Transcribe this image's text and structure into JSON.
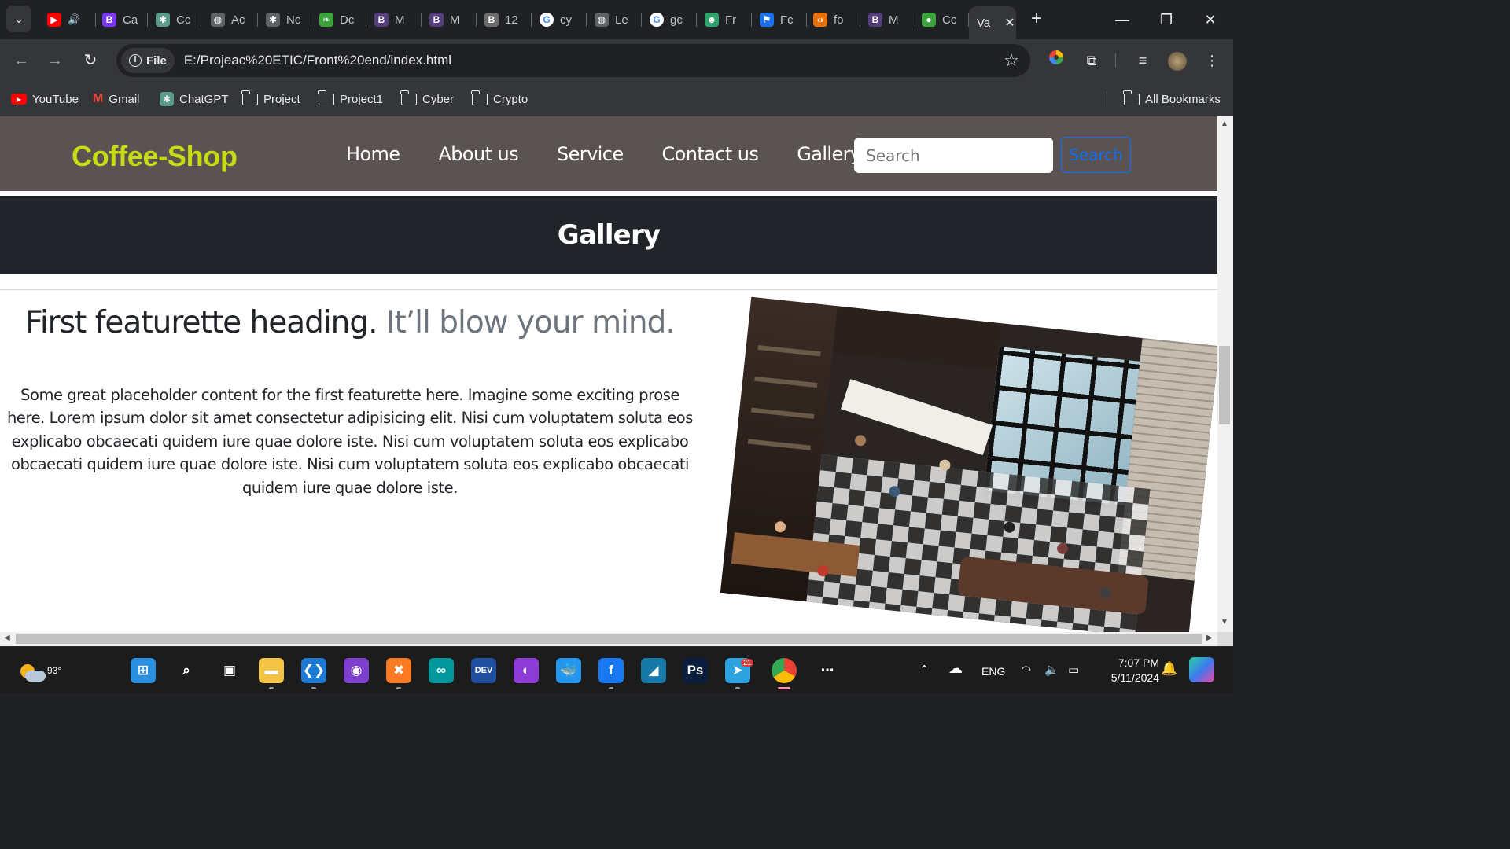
{
  "browser": {
    "tabs": [
      {
        "label": "",
        "favicon": "youtube-icon",
        "color": "#ff0000",
        "glyph": "▶",
        "extra": "🔊"
      },
      {
        "label": "Ca",
        "favicon": "bootstrap-icon",
        "color": "#7a38f5",
        "glyph": "B"
      },
      {
        "label": "Cc",
        "favicon": "chatgpt-icon",
        "color": "#5b9b8a",
        "glyph": "✱"
      },
      {
        "label": "Ac",
        "favicon": "globe-icon",
        "color": "#5f6368",
        "glyph": "◍"
      },
      {
        "label": "Nc",
        "favicon": "chatgpt-icon",
        "color": "#5f6368",
        "glyph": "✱"
      },
      {
        "label": "Dc",
        "favicon": "leaf-icon",
        "color": "#3aa33a",
        "glyph": "❧"
      },
      {
        "label": "M",
        "favicon": "bootstrap-icon",
        "color": "#563d7c",
        "glyph": "B"
      },
      {
        "label": "M",
        "favicon": "bootstrap-icon",
        "color": "#563d7c",
        "glyph": "B"
      },
      {
        "label": "12",
        "favicon": "bootstrap-icon",
        "color": "#6c6c6c",
        "glyph": "B"
      },
      {
        "label": "cy",
        "favicon": "google-icon",
        "color": "#ffffff",
        "glyph": "G"
      },
      {
        "label": "Le",
        "favicon": "globe-icon",
        "color": "#5f6368",
        "glyph": "◍"
      },
      {
        "label": "gc",
        "favicon": "google-icon",
        "color": "#ffffff",
        "glyph": "G"
      },
      {
        "label": "Fr",
        "favicon": "robot-icon",
        "color": "#2fa36b",
        "glyph": "☻"
      },
      {
        "label": "Fc",
        "favicon": "flag-icon",
        "color": "#1a73e8",
        "glyph": "⚑"
      },
      {
        "label": "fo",
        "favicon": "code-icon",
        "color": "#e8710a",
        "glyph": "‹›"
      },
      {
        "label": "M",
        "favicon": "bootstrap-icon",
        "color": "#563d7c",
        "glyph": "B"
      },
      {
        "label": "Cc",
        "favicon": "cookie-icon",
        "color": "#3aa33a",
        "glyph": "●"
      },
      {
        "label": "Va",
        "favicon": "",
        "color": "",
        "glyph": "",
        "active": true
      }
    ],
    "address": {
      "chip_label": "File",
      "url": "E:/Projeac%20ETIC/Front%20end/index.html"
    },
    "bookmarks": [
      {
        "label": "YouTube",
        "icon": "youtube-icon"
      },
      {
        "label": "Gmail",
        "icon": "gmail-icon"
      },
      {
        "label": "ChatGPT",
        "icon": "chatgpt-icon"
      },
      {
        "label": "Project",
        "icon": "folder-icon"
      },
      {
        "label": "Project1",
        "icon": "folder-icon"
      },
      {
        "label": "Cyber",
        "icon": "folder-icon"
      },
      {
        "label": "Crypto",
        "icon": "folder-icon"
      }
    ],
    "all_bookmarks_label": "All Bookmarks"
  },
  "site": {
    "brand": "Coffee-Shop",
    "nav": [
      "Home",
      "About us",
      "Service",
      "Contact us",
      "Gallery"
    ],
    "search_placeholder": "Search",
    "search_button": "Search",
    "banner_title": "Gallery",
    "featurette": {
      "heading": "First featurette heading.",
      "heading_muted": "It’ll blow your mind.",
      "text": "Some great placeholder content for the first featurette here. Imagine some exciting prose here. Lorem ipsum dolor sit amet consectetur adipisicing elit. Nisi cum voluptatem soluta eos explicabo obcaecati quidem iure quae dolore iste. Nisi cum voluptatem soluta eos explicabo obcaecati quidem iure quae dolore iste. Nisi cum voluptatem soluta eos explicabo obcaecati quidem iure quae dolore iste."
    },
    "brand_color": "#c8dc14",
    "navbar_color": "#5a5351",
    "banner_color": "#212529"
  },
  "taskbar": {
    "weather_temp": "93°",
    "apps": [
      {
        "name": "windows-start-icon",
        "glyph": "⊞",
        "color": "#2b8fe0"
      },
      {
        "name": "search-icon",
        "glyph": "⌕",
        "color": "transparent"
      },
      {
        "name": "task-view-icon",
        "glyph": "▣",
        "color": "transparent"
      },
      {
        "name": "file-explorer-icon",
        "glyph": "▬",
        "color": "#f3c443"
      },
      {
        "name": "vscode-icon",
        "glyph": "❮❯",
        "color": "#1f7ad4"
      },
      {
        "name": "tor-browser-icon",
        "glyph": "◉",
        "color": "#7e3fcf"
      },
      {
        "name": "xampp-icon",
        "glyph": "✖",
        "color": "#fb7a24"
      },
      {
        "name": "arduino-icon",
        "glyph": "∞",
        "color": "#00979d"
      },
      {
        "name": "dev-cpp-icon",
        "glyph": "DEV",
        "color": "#1f4f9e"
      },
      {
        "name": "mask-app-icon",
        "glyph": "◐",
        "color": "#8e3cd6"
      },
      {
        "name": "docker-icon",
        "glyph": "🐳",
        "color": "#2496ed"
      },
      {
        "name": "facebook-icon",
        "glyph": "f",
        "color": "#1877f2"
      },
      {
        "name": "wireshark-icon",
        "glyph": "◢",
        "color": "#1679a7"
      },
      {
        "name": "photoshop-icon",
        "glyph": "Ps",
        "color": "#0b1d3c"
      },
      {
        "name": "telegram-icon",
        "glyph": "➤",
        "color": "#2aa3e0",
        "badge": "21"
      },
      {
        "name": "chrome-icon",
        "glyph": "◎",
        "color": "#e8453c"
      },
      {
        "name": "more-apps-icon",
        "glyph": "⋯",
        "color": "transparent"
      }
    ],
    "language": "ENG",
    "time": "7:07 PM",
    "date": "5/11/2024"
  }
}
